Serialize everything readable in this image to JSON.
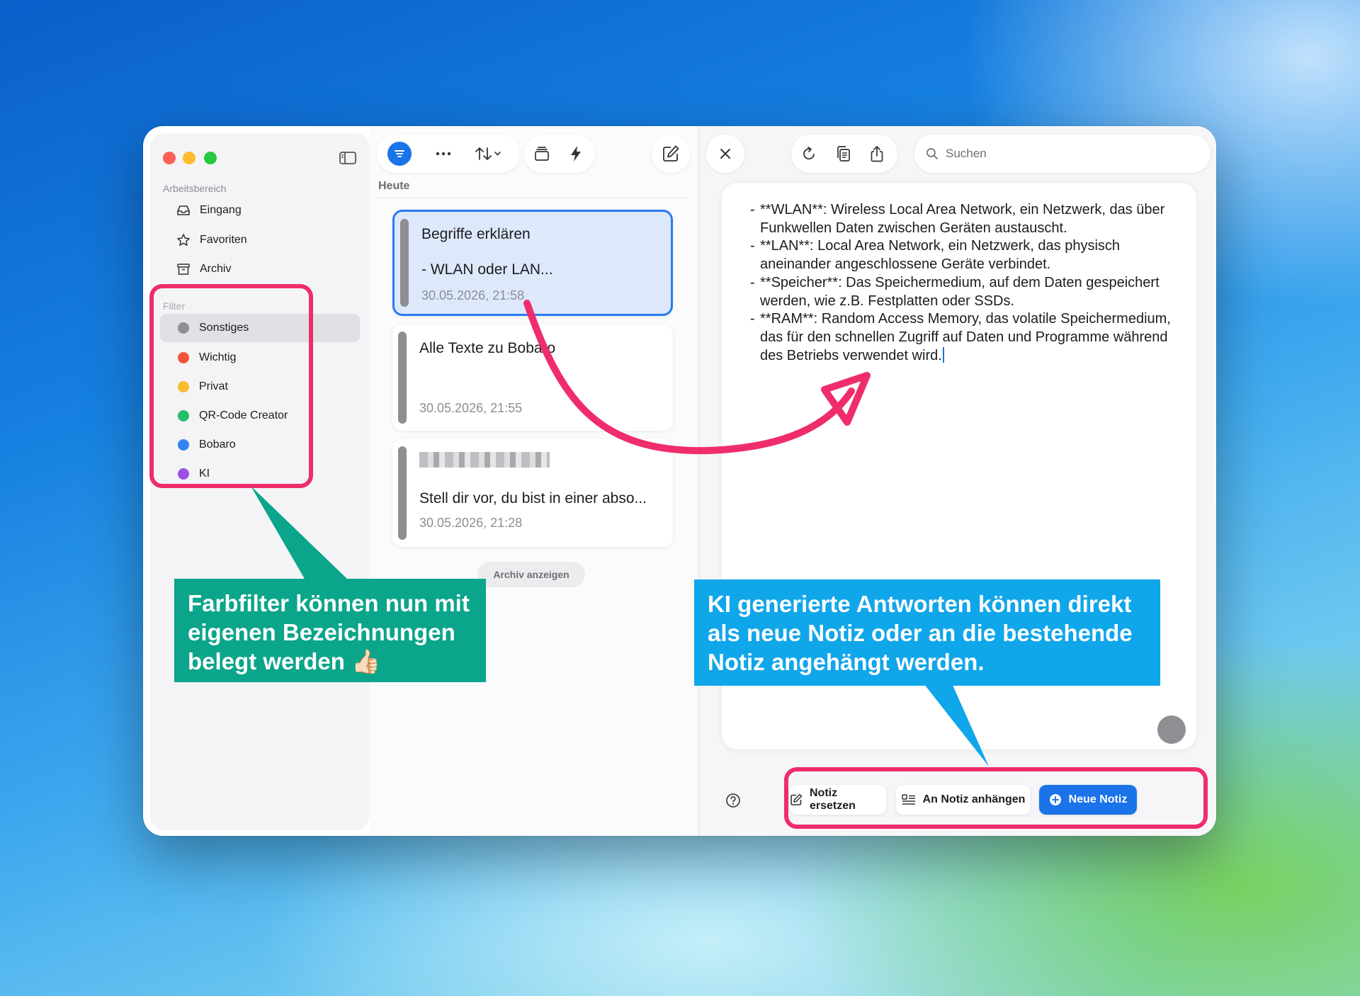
{
  "sidebar": {
    "workspace_label": "Arbeitsbereich",
    "workspace_items": [
      {
        "label": "Eingang",
        "icon": "inbox-icon"
      },
      {
        "label": "Favoriten",
        "icon": "star-icon"
      },
      {
        "label": "Archiv",
        "icon": "archive-icon"
      }
    ],
    "filter_label": "Filter",
    "filter_items": [
      {
        "label": "Sonstiges",
        "color": "#8e8e93",
        "active": true
      },
      {
        "label": "Wichtig",
        "color": "#f0573a"
      },
      {
        "label": "Privat",
        "color": "#fbbc2c"
      },
      {
        "label": "QR-Code Creator",
        "color": "#22c06a"
      },
      {
        "label": "Bobaro",
        "color": "#3583f0"
      },
      {
        "label": "KI",
        "color": "#9c50e8"
      }
    ]
  },
  "notes": {
    "section_label": "Heute",
    "cards": [
      {
        "title": "Begriffe erklären",
        "preview": "- WLAN oder LAN...",
        "date": "30.05.2026, 21:58",
        "selected": true
      },
      {
        "title": "Alle Texte zu Bobaro",
        "preview": "",
        "date": "30.05.2026, 21:55"
      },
      {
        "title": "",
        "preview": "Stell dir vor, du bist in einer abso...",
        "date": "30.05.2026, 21:28",
        "title_blurred": true
      }
    ],
    "archive_button": "Archiv anzeigen"
  },
  "editor": {
    "search_placeholder": "Suchen",
    "lines": [
      {
        "text": "**WLAN**: Wireless Local Area Network, ein Netzwerk, das über Funkwellen Daten zwischen Geräten austauscht."
      },
      {
        "text": "**LAN**: Local Area Network, ein Netzwerk, das physisch aneinander angeschlossene Geräte verbindet."
      },
      {
        "text": "**Speicher**: Das Speichermedium, auf dem Daten gespeichert werden, wie z.B. Festplatten oder SSDs."
      },
      {
        "text": "**RAM**: Random Access Memory, das volatile Speichermedium, das für den schnellen Zugriff auf Daten und Programme während des Betriebs verwendet wird."
      }
    ],
    "actions": {
      "replace": "Notiz ersetzen",
      "append": "An Notiz anhängen",
      "new": "Neue Notiz"
    }
  },
  "annotations": {
    "left_callout": "Farbfilter können nun mit eigenen Bezeichnungen belegt werden",
    "left_emoji": "👍🏻",
    "right_callout": "KI generierte Antworten können direkt als neue Notiz oder an die bestehende Notiz angehängt werden.",
    "highlight_color": "#ef2d6b",
    "left_callout_color": "#0aa58a",
    "right_callout_color": "#10a6ea"
  },
  "colors": {
    "accent": "#1a73e8",
    "selected_card_bg": "#dde8fb"
  }
}
